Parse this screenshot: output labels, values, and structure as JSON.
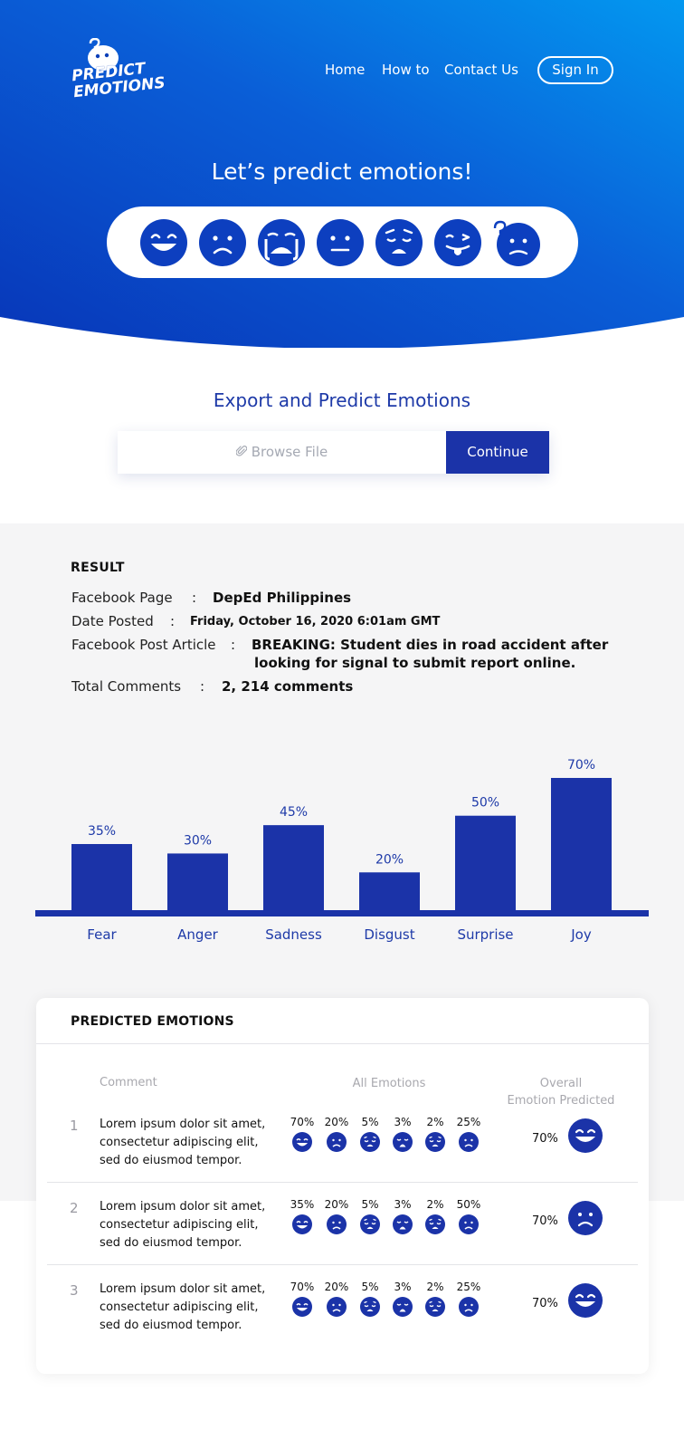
{
  "brand": {
    "logo_line1": "PREDICT",
    "logo_line2": "EMOTIONS"
  },
  "nav": {
    "home": "Home",
    "how_to": "How to",
    "contact": "Contact Us",
    "sign_in": "Sign In"
  },
  "hero": {
    "title": "Let’s predict emotions!",
    "emojis": [
      "grinning-face-icon",
      "frowning-face-icon",
      "crying-face-icon",
      "neutral-face-icon",
      "weary-face-icon",
      "tongue-out-face-icon",
      "confused-face-icon"
    ]
  },
  "export": {
    "title": "Export and Predict Emotions",
    "browse_label": "Browse File",
    "continue_label": "Continue"
  },
  "result": {
    "heading": "RESULT",
    "fields": [
      {
        "label": "Facebook Page",
        "value": "DepEd Philippines"
      },
      {
        "label": "Date Posted",
        "value": "Friday, October 16, 2020 6:01am GMT"
      },
      {
        "label": "Facebook Post Article",
        "value_line1": "BREAKING: Student dies in road accident after",
        "value_line2": "looking for signal to submit report online."
      },
      {
        "label": "Total Comments",
        "value": "2, 214 comments"
      }
    ],
    "colon": ":"
  },
  "chart_data": {
    "type": "bar",
    "categories": [
      "Fear",
      "Anger",
      "Sadness",
      "Disgust",
      "Surprise",
      "Joy"
    ],
    "values": [
      35,
      30,
      45,
      20,
      50,
      70
    ],
    "value_labels": [
      "35%",
      "30%",
      "45%",
      "20%",
      "50%",
      "70%"
    ],
    "ylim": [
      0,
      70
    ],
    "bar_color": "#1b33a8",
    "grid": false
  },
  "predicted": {
    "title": "PREDICTED EMOTIONS",
    "col_comment": "Comment",
    "col_all": "All Emotions",
    "col_overall_line1": "Overall",
    "col_overall_line2": "Emotion Predicted",
    "emotion_icons": [
      "smile-icon",
      "sad-icon",
      "weary-icon",
      "surprised-icon",
      "weary-icon",
      "sad-icon"
    ],
    "rows": [
      {
        "num": "1",
        "comment_line1": "Lorem ipsum dolor sit amet,",
        "comment_line2": "consectetur adipiscing elit,",
        "comment_line3": "sed do eiusmod tempor.",
        "percents": [
          "70%",
          "20%",
          "5%",
          "3%",
          "2%",
          "25%"
        ],
        "overall_pct": "70%",
        "overall_icon": "grinning-face-icon"
      },
      {
        "num": "2",
        "comment_line1": "Lorem ipsum dolor sit amet,",
        "comment_line2": "consectetur adipiscing elit,",
        "comment_line3": "sed do eiusmod tempor.",
        "percents": [
          "35%",
          "20%",
          "5%",
          "3%",
          "2%",
          "50%"
        ],
        "overall_pct": "70%",
        "overall_icon": "frowning-face-icon"
      },
      {
        "num": "3",
        "comment_line1": "Lorem ipsum dolor sit amet,",
        "comment_line2": "consectetur adipiscing elit,",
        "comment_line3": "sed do eiusmod tempor.",
        "percents": [
          "70%",
          "20%",
          "5%",
          "3%",
          "2%",
          "25%"
        ],
        "overall_pct": "70%",
        "overall_icon": "grinning-face-icon"
      }
    ]
  },
  "colors": {
    "brand_blue": "#1b33a8",
    "hero_gradient_start": "#0a3ec0",
    "hero_gradient_end": "#0492ee",
    "section_gray": "#f5f5f6"
  }
}
